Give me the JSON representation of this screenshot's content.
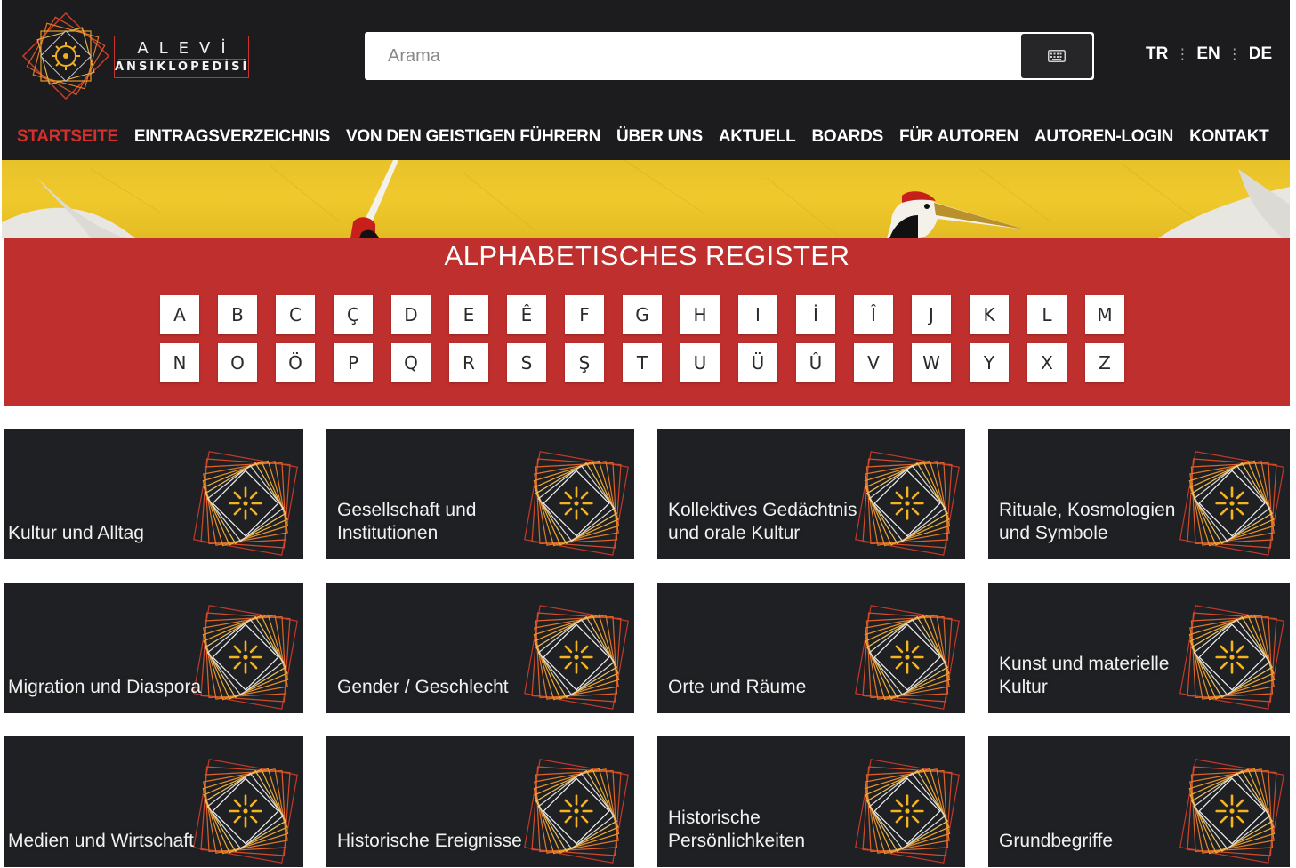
{
  "header": {
    "logo": {
      "line1": "ALEVİ",
      "line2": "ANSİKLOPEDİSİ"
    },
    "search": {
      "placeholder": "Arama",
      "button_icon": "keyboard-icon"
    },
    "languages": [
      "TR",
      "EN",
      "DE"
    ],
    "nav": [
      {
        "label": "STARTSEITE",
        "active": true
      },
      {
        "label": "EINTRAGSVERZEICHNIS",
        "active": false
      },
      {
        "label": "VON DEN GEISTIGEN FÜHRERN",
        "active": false
      },
      {
        "label": "ÜBER UNS",
        "active": false
      },
      {
        "label": "AKTUELL",
        "active": false
      },
      {
        "label": "BOARDS",
        "active": false
      },
      {
        "label": "FÜR AUTOREN",
        "active": false
      },
      {
        "label": "AUTOREN-LOGIN",
        "active": false
      },
      {
        "label": "KONTAKT",
        "active": false
      }
    ]
  },
  "register": {
    "title": "ALPHABETISCHES REGISTER",
    "row1": [
      "A",
      "B",
      "C",
      "Ç",
      "D",
      "E",
      "Ê",
      "F",
      "G",
      "H",
      "I",
      "İ",
      "Î",
      "J",
      "K",
      "L",
      "M"
    ],
    "row2": [
      "N",
      "O",
      "Ö",
      "P",
      "Q",
      "R",
      "S",
      "Ş",
      "T",
      "U",
      "Ü",
      "Û",
      "V",
      "W",
      "Y",
      "X",
      "Z"
    ]
  },
  "categories": [
    [
      "Kultur und Alltag"
    ],
    [
      "Gesellschaft und",
      "Institutionen"
    ],
    [
      "Kollektives Gedächtnis",
      "und orale Kultur"
    ],
    [
      "Rituale, Kosmologien",
      "und Symbole"
    ],
    [
      "Migration und Diaspora"
    ],
    [
      "Gender / Geschlecht"
    ],
    [
      "Orte und Räume"
    ],
    [
      "Kunst und materielle",
      "Kultur"
    ],
    [
      "Medien und Wirtschaft"
    ],
    [
      "Historische Ereignisse"
    ],
    [
      "Historische",
      "Persönlichkeiten"
    ],
    [
      "Grundbegriffe"
    ]
  ],
  "colors": {
    "header_bg": "#1c1b1d",
    "accent_red": "#be2f2d",
    "active_nav": "#d2302c",
    "card_bg": "#1f2023",
    "banner_gold": "#efc92c"
  }
}
